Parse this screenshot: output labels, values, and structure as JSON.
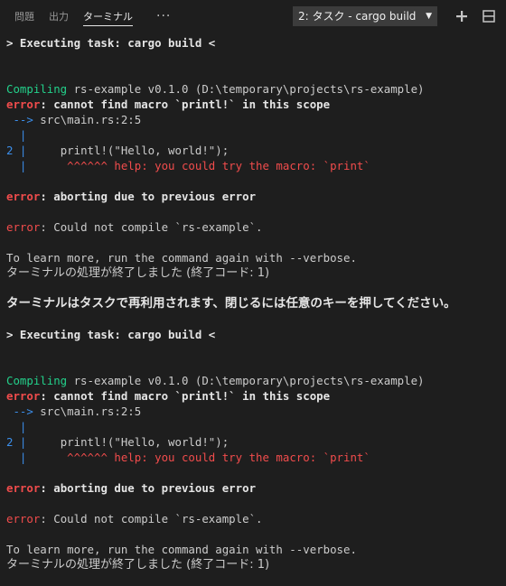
{
  "panel": {
    "tabs": [
      {
        "label": "問題"
      },
      {
        "label": "出力"
      },
      {
        "label": "ターミナル"
      }
    ],
    "more_label": "···",
    "terminal_selector": {
      "value": "2: タスク - cargo build",
      "caret": "▼"
    },
    "actions": [
      {
        "name": "new-terminal",
        "icon": "plus-icon"
      },
      {
        "name": "split-terminal",
        "icon": "split-icon"
      }
    ]
  },
  "terminal": {
    "block": {
      "exec_line": "> Executing task: cargo build <",
      "compiling_word": "Compiling",
      "compiling_rest": " rs-example v0.1.0 (D:\\temporary\\projects\\rs-example)",
      "error_word": "error",
      "error1_msg": ": cannot find macro `printl!` in this scope",
      "arrow": " -->",
      "location": " src\\main.rs:2:5",
      "pipe": "  |",
      "lineno": "2",
      "code_pipe": " |",
      "code": "     printl!(\"Hello, world!\");",
      "hint_pipe": "  |",
      "hint": "      ^^^^^^ help: you could try the macro: `print`",
      "error2_msg": ": aborting due to previous error",
      "error3_msg": ": Could not compile `rs-example`.",
      "learn_more": "To learn more, run the command again with --verbose.",
      "exit_line": "ターミナルの処理が終了しました (終了コード: 1)",
      "reuse_line": "ターミナルはタスクで再利用されます、閉じるには任意のキーを押してください。"
    }
  },
  "colors": {
    "background": "#1e1e1e",
    "green": "#23d18b",
    "red": "#f14c4c",
    "blue": "#3b8eea"
  }
}
